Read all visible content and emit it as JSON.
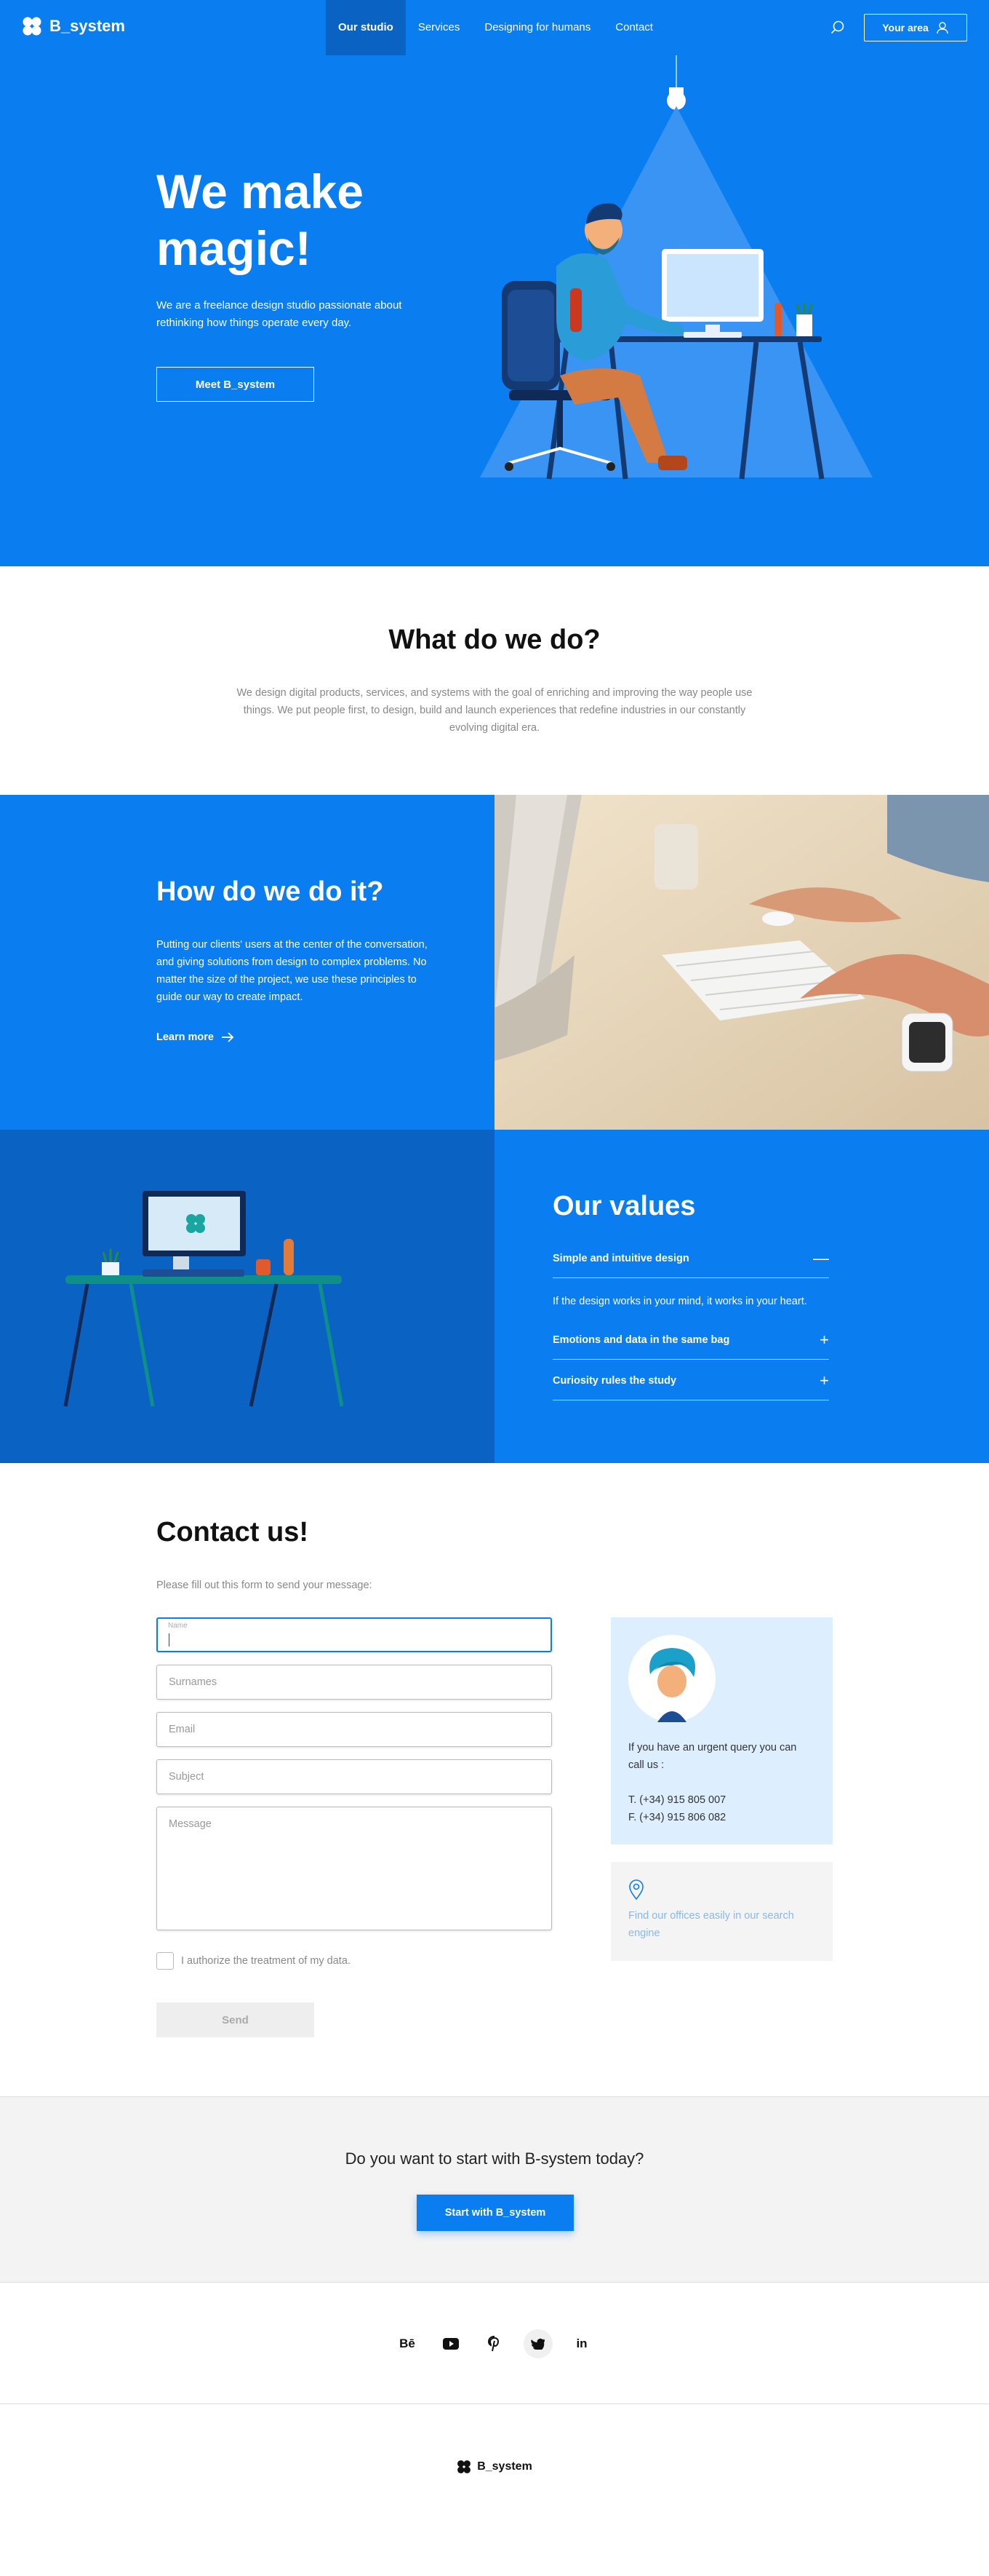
{
  "header": {
    "brand": "B_system",
    "nav": [
      "Our studio",
      "Services",
      "Designing for humans",
      "Contact"
    ],
    "your_area": "Your area"
  },
  "hero": {
    "title": "We make magic!",
    "text": "We are a freelance design studio passionate about rethinking how things operate every day.",
    "button": "Meet B_system"
  },
  "what": {
    "title": "What do we do?",
    "text": "We design digital products, services, and systems with the goal of enriching and improving the way people use things. We put people first, to design, build and launch experiences that redefine industries in our constantly evolving digital era."
  },
  "how": {
    "title": "How do we do it?",
    "text": "Putting our clients' users at the center of the conversation, and giving solutions from design to complex problems. No matter the size of the project, we use these principles to guide our way to create impact.",
    "link": "Learn more"
  },
  "values": {
    "title": "Our values",
    "items": [
      {
        "label": "Simple and intuitive design",
        "body": "If the design works in your mind, it works in your heart."
      },
      {
        "label": "Emotions and data in the same bag"
      },
      {
        "label": "Curiosity rules the study"
      }
    ]
  },
  "contact": {
    "title": "Contact us!",
    "subtitle": "Please fill out this form to send your message:",
    "fields": {
      "name": "Name",
      "surnames": "Surnames",
      "email": "Email",
      "subject": "Subject",
      "message": "Message"
    },
    "consent": "I authorize the treatment of my data.",
    "send": "Send",
    "card": {
      "text": "If you have an urgent query you can call us :",
      "phone": "T. (+34) 915 805 007",
      "fax": "F. (+34) 915 806 082"
    },
    "offices_link": "Find our offices easily in our search engine"
  },
  "cta": {
    "text": "Do you want to start with B-system today?",
    "button": "Start with B_system"
  },
  "social": [
    "Bē",
    "youtube-icon",
    "pinterest-icon",
    "twitter-icon",
    "in"
  ],
  "footer": {
    "brand": "B_system"
  },
  "colors": {
    "primary": "#0a7ef0",
    "primary_dark": "#0a63c2",
    "card_bg": "#ddeefe"
  }
}
